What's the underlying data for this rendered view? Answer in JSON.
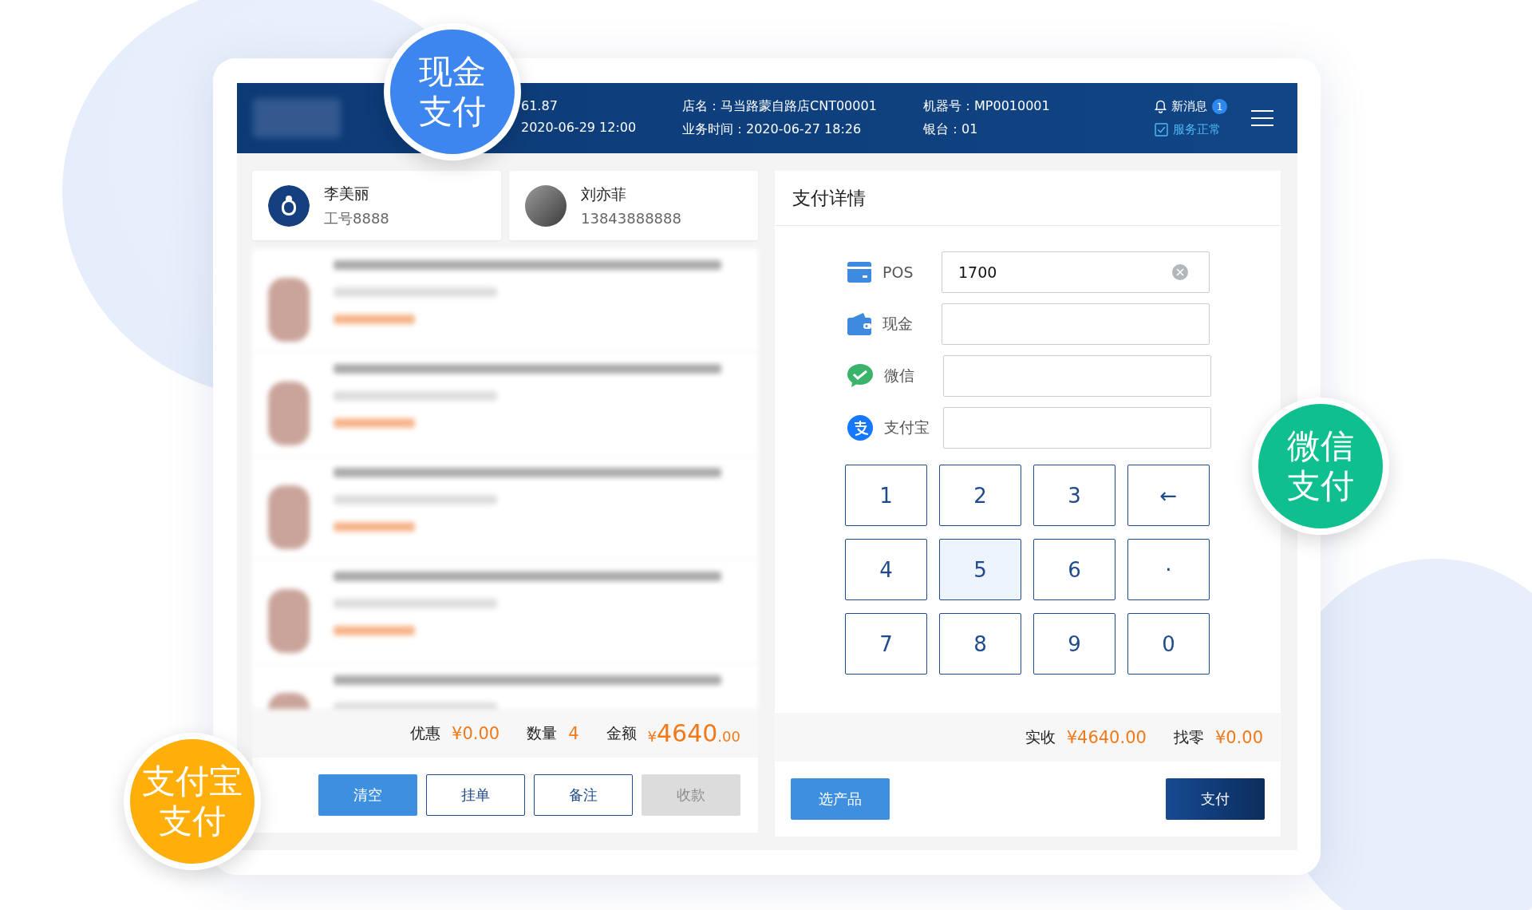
{
  "badges": [
    {
      "lines": [
        "现金",
        "支付"
      ],
      "color": "#3d86f0"
    },
    {
      "lines": [
        "微信",
        "支付"
      ],
      "color": "#0fbf8f"
    },
    {
      "lines": [
        "支付宝",
        "支付"
      ],
      "color": "#ffae0a"
    }
  ],
  "header": {
    "info": [
      {
        "lines": [
          "61.87",
          "2020-06-29 12:00"
        ]
      },
      {
        "lines": [
          "店名：马当路蒙自路店CNT00001",
          "业务时间：2020-06-27 18:26"
        ]
      },
      {
        "lines": [
          "机器号：MP0010001",
          "银台：01"
        ]
      }
    ],
    "notice": {
      "label": "新消息",
      "count": "1"
    },
    "status": "服务正常"
  },
  "customers": [
    {
      "kind": "staff",
      "name": "李美丽",
      "detail": "工号8888"
    },
    {
      "kind": "member",
      "name": "刘亦菲",
      "detail": "13843888888"
    }
  ],
  "summary": [
    {
      "kind": "plain",
      "label": "优惠",
      "value": "¥0.00"
    },
    {
      "kind": "plain",
      "label": "数量",
      "value": "4"
    },
    {
      "kind": "big",
      "label": "金额",
      "currency": "¥",
      "value": "4640",
      "fraction": ".00"
    }
  ],
  "order_buttons": [
    {
      "label": "清空",
      "kind": "primary",
      "disabled": false
    },
    {
      "label": "挂单",
      "kind": "outline",
      "disabled": false
    },
    {
      "label": "备注",
      "kind": "outline",
      "disabled": false
    },
    {
      "label": "收款",
      "kind": "primary",
      "disabled": true
    }
  ],
  "payment": {
    "title": "支付详情",
    "methods": [
      {
        "kind": "pos",
        "label": "POS",
        "value": "1700"
      },
      {
        "kind": "cash",
        "label": "现金"
      },
      {
        "kind": "wechat",
        "label": "微信"
      },
      {
        "kind": "alipay",
        "label": "支付宝"
      }
    ],
    "keys": [
      {
        "label": "1",
        "selected": false
      },
      {
        "label": "2",
        "selected": false
      },
      {
        "label": "3",
        "selected": false
      },
      {
        "label": "←",
        "selected": false
      },
      {
        "label": "4",
        "selected": false
      },
      {
        "label": "5",
        "selected": true
      },
      {
        "label": "6",
        "selected": false
      },
      {
        "label": "·",
        "selected": false
      },
      {
        "label": "7",
        "selected": false
      },
      {
        "label": "8",
        "selected": false
      },
      {
        "label": "9",
        "selected": false
      },
      {
        "label": "0",
        "selected": false
      }
    ],
    "totals": [
      {
        "label": "实收",
        "value": "¥4640.00"
      },
      {
        "label": "找零",
        "value": "¥0.00"
      }
    ],
    "buttons": [
      {
        "label": "选产品",
        "kind": "primary"
      },
      {
        "label": "支付",
        "kind": "dark"
      }
    ]
  }
}
